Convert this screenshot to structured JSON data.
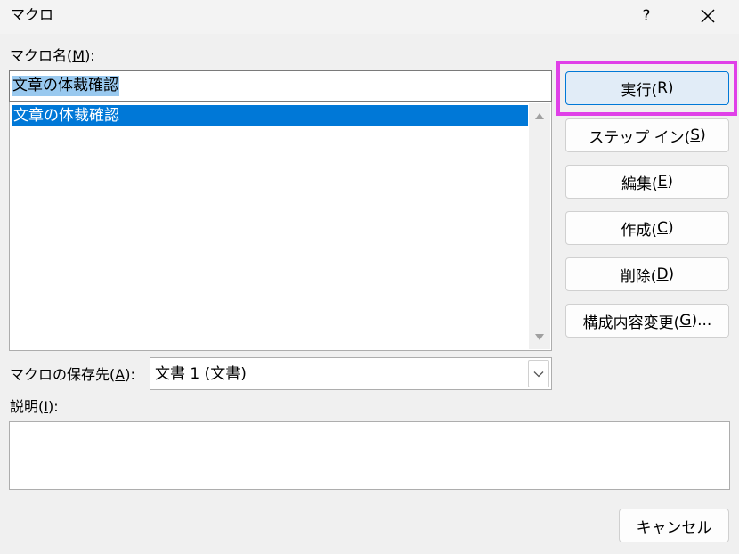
{
  "window": {
    "title": "マクロ",
    "help_label": "?"
  },
  "macro_name": {
    "label_prefix": "マクロ名(",
    "label_key": "M",
    "label_suffix": "):",
    "value": "文章の体裁確認"
  },
  "macro_list": {
    "items": [
      "文章の体裁確認"
    ],
    "selected_index": 0
  },
  "buttons": {
    "run": {
      "text": "実行(",
      "key": "R",
      "end": ")"
    },
    "step_in": {
      "text": "ステップ イン(",
      "key": "S",
      "end": ")"
    },
    "edit": {
      "text": "編集(",
      "key": "E",
      "end": ")"
    },
    "create": {
      "text": "作成(",
      "key": "C",
      "end": ")"
    },
    "delete": {
      "text": "削除(",
      "key": "D",
      "end": ")"
    },
    "organizer": {
      "text": "構成内容変更(",
      "key": "G",
      "end": ")..."
    },
    "cancel": {
      "text": "キャンセル"
    }
  },
  "macros_in": {
    "label_prefix": "マクロの保存先(",
    "label_key": "A",
    "label_suffix": "):",
    "selected_value": "文書 1 (文書)"
  },
  "description": {
    "label_prefix": "説明(",
    "label_key": "I",
    "label_suffix": "):",
    "value": ""
  },
  "colors": {
    "selection": "#0078d7",
    "text_selection": "#99c9ef",
    "highlight_frame": "#e040e8"
  }
}
